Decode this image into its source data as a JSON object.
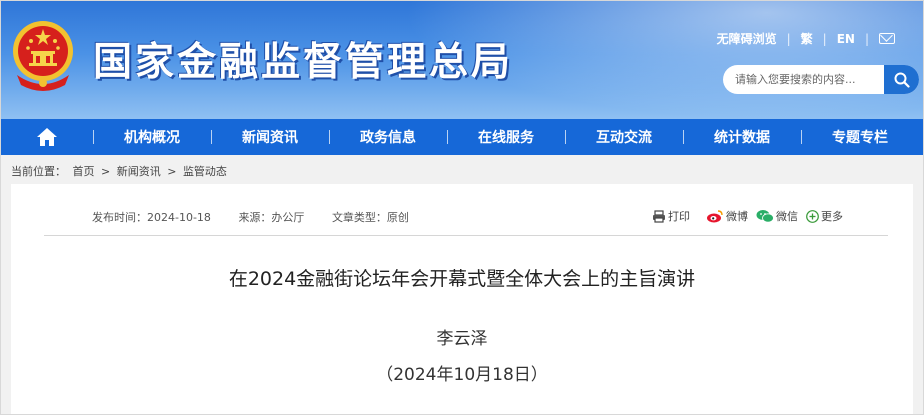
{
  "header": {
    "site_title": "国家金融监督管理总局",
    "accessibility": "无障碍浏览",
    "traditional": "繁",
    "english": "EN",
    "search_placeholder": "请输入您要搜索的内容..."
  },
  "nav": {
    "items": [
      {
        "label": "机构概况"
      },
      {
        "label": "新闻资讯"
      },
      {
        "label": "政务信息"
      },
      {
        "label": "在线服务"
      },
      {
        "label": "互动交流"
      },
      {
        "label": "统计数据"
      },
      {
        "label": "专题专栏"
      }
    ]
  },
  "breadcrumb": {
    "prefix": "当前位置：",
    "items": [
      "首页",
      "新闻资讯",
      "监管动态"
    ],
    "separator": ">"
  },
  "article": {
    "publish_time": "发布时间：2024-10-18",
    "source": "来源：办公厅",
    "type": "文章类型：原创",
    "title": "在2024金融街论坛年会开幕式暨全体大会上的主旨演讲",
    "author": "李云泽",
    "date": "（2024年10月18日）"
  },
  "share": {
    "print": "打印",
    "weibo": "微博",
    "wechat": "微信",
    "more": "更多"
  },
  "colors": {
    "nav_bg": "#1668d8",
    "header_top": "#2f76d8",
    "breadcrumb_bg": "#f1f1f1"
  },
  "icons": [
    "national-emblem-icon",
    "mail-icon",
    "search-icon",
    "home-icon",
    "print-icon",
    "weibo-icon",
    "wechat-icon",
    "plus-circle-icon"
  ]
}
